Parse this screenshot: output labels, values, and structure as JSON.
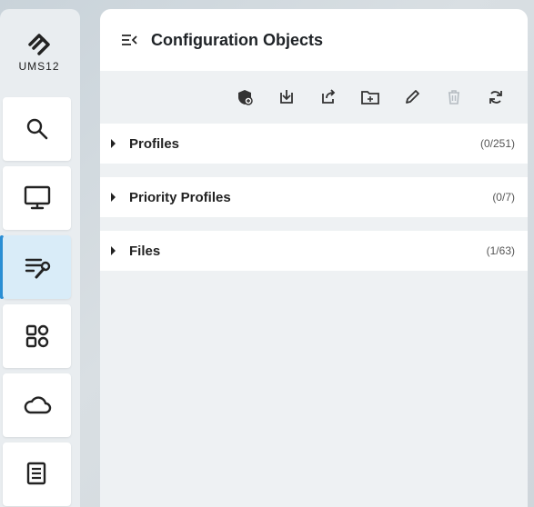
{
  "sidebar": {
    "logo_text": "UMS12",
    "items": [
      {
        "icon": "search-icon"
      },
      {
        "icon": "monitor-icon"
      },
      {
        "icon": "configuration-icon",
        "active": true
      },
      {
        "icon": "apps-icon"
      },
      {
        "icon": "cloud-icon"
      },
      {
        "icon": "document-icon"
      }
    ]
  },
  "panel": {
    "title": "Configuration Objects",
    "toolbar": [
      "shield-add-icon",
      "import-icon",
      "export-icon",
      "new-folder-icon",
      "edit-icon",
      "delete-icon",
      "refresh-icon"
    ],
    "rows": [
      {
        "label": "Profiles",
        "count": "(0/251)"
      },
      {
        "label": "Priority Profiles",
        "count": "(0/7)"
      },
      {
        "label": "Files",
        "count": "(1/63)"
      }
    ]
  },
  "colors": {
    "accent": "#2a8fd6",
    "active_bg": "#d9ecf8"
  }
}
